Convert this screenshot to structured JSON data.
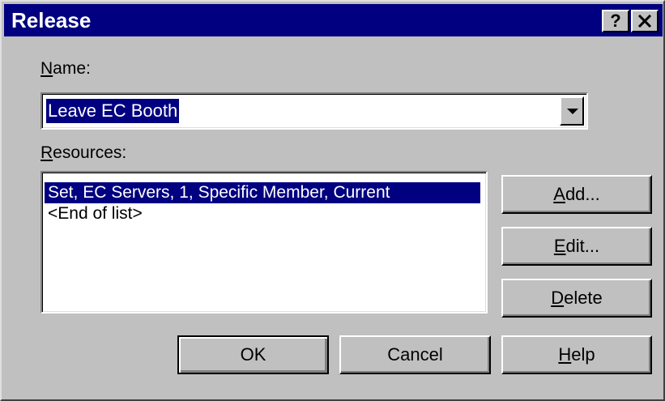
{
  "window": {
    "title": "Release",
    "help_button": "?",
    "close_button": "✕"
  },
  "name": {
    "label_mnemonic": "N",
    "label_rest": "ame:",
    "value": "Leave EC Booth"
  },
  "resources": {
    "label_mnemonic": "R",
    "label_rest": "esources:",
    "items": [
      "Set, EC Servers, 1, Specific Member, Current",
      "<End of list>"
    ]
  },
  "buttons": {
    "add": {
      "mnemonic": "A",
      "rest": "dd..."
    },
    "edit": {
      "mnemonic": "E",
      "rest": "dit..."
    },
    "delete": {
      "mnemonic": "D",
      "rest": "elete"
    },
    "ok": "OK",
    "cancel": "Cancel",
    "help": {
      "mnemonic": "H",
      "rest": "elp"
    }
  },
  "colors": {
    "face": "#c0c0c0",
    "titlebar": "#000080",
    "selection": "#000080"
  }
}
